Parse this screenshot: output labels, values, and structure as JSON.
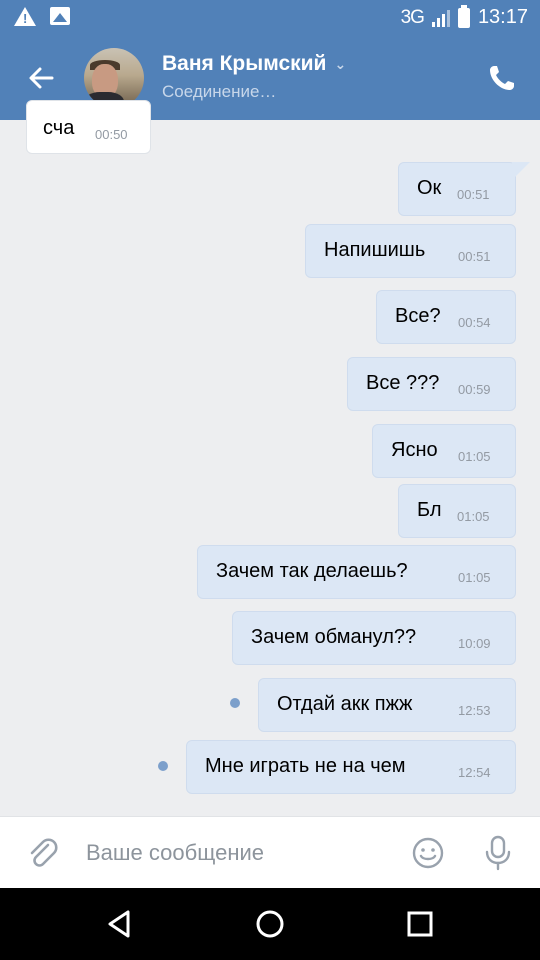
{
  "status_bar": {
    "network": "3G",
    "time": "13:17"
  },
  "header": {
    "contact_name": "Ваня Крымский",
    "status": "Соединение…"
  },
  "messages": [
    {
      "text": "сча",
      "time": "00:50",
      "direction": "incoming"
    },
    {
      "text": "Ок",
      "time": "00:51",
      "direction": "outgoing"
    },
    {
      "text": "Напишишь",
      "time": "00:51",
      "direction": "outgoing"
    },
    {
      "text": "Все?",
      "time": "00:54",
      "direction": "outgoing"
    },
    {
      "text": "Все ???",
      "time": "00:59",
      "direction": "outgoing"
    },
    {
      "text": "Ясно",
      "time": "01:05",
      "direction": "outgoing"
    },
    {
      "text": "Бл",
      "time": "01:05",
      "direction": "outgoing"
    },
    {
      "text": "Зачем так делаешь?",
      "time": "01:05",
      "direction": "outgoing"
    },
    {
      "text": "Зачем обманул??",
      "time": "10:09",
      "direction": "outgoing"
    },
    {
      "text": "Отдай акк пжж",
      "time": "12:53",
      "direction": "outgoing",
      "unread": true
    },
    {
      "text": "Мне играть не на чем",
      "time": "12:54",
      "direction": "outgoing",
      "unread": true
    }
  ],
  "composer": {
    "placeholder": "Ваше сообщение"
  },
  "icons": {
    "back": "arrow-left-icon",
    "call": "phone-icon",
    "attach": "paperclip-icon",
    "emoji": "smiley-icon",
    "mic": "microphone-icon",
    "nav_back": "triangle-back-icon",
    "nav_home": "circle-home-icon",
    "nav_recents": "square-recents-icon"
  },
  "colors": {
    "header": "#5181b8",
    "outgoing_bubble": "#dce7f5",
    "incoming_bubble": "#ffffff",
    "background": "#edeef0",
    "unread_dot": "#7c9fcb"
  }
}
